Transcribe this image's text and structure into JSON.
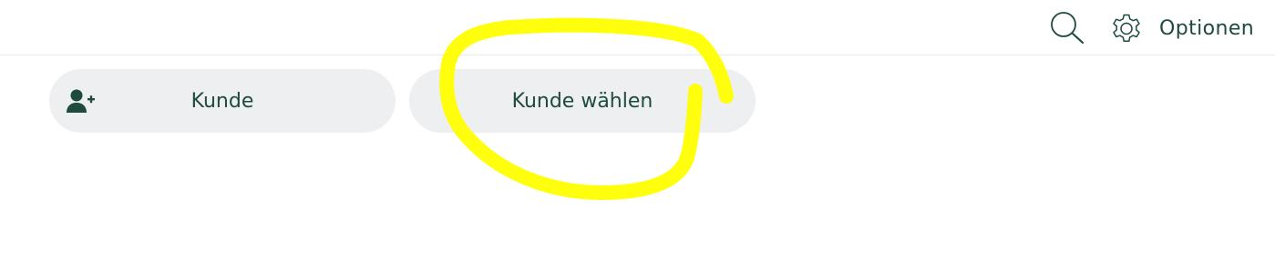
{
  "header": {
    "search_icon": "search-icon",
    "options_icon": "gear-icon",
    "options_label": "Optionen"
  },
  "buttons": {
    "customer": {
      "icon": "add-user-icon",
      "label": "Kunde"
    },
    "choose_customer": {
      "label": "Kunde wählen"
    }
  },
  "annotation": {
    "color": "#ffff00"
  },
  "colors": {
    "text_accent": "#1e4a3f",
    "pill_background": "#eeeff1",
    "divider": "#e9ebea"
  }
}
